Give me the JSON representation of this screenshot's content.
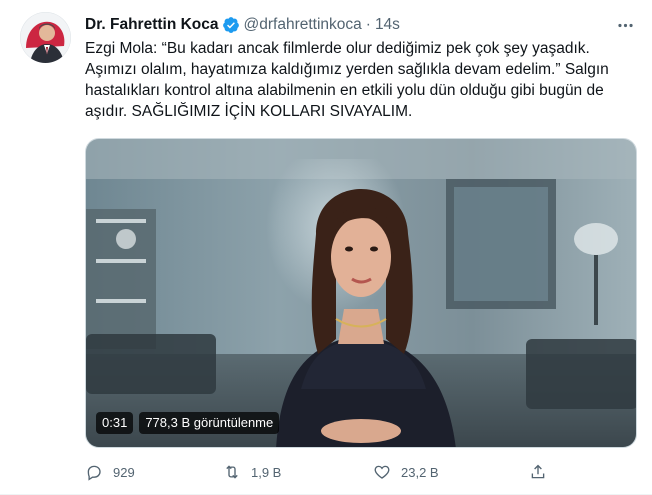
{
  "author": {
    "name": "Dr. Fahrettin Koca",
    "handle": "@drfahrettinkoca",
    "separator": "·",
    "time": "14s"
  },
  "tweet": {
    "text": "Ezgi Mola: “Bu kadarı ancak filmlerde olur dediğimiz pek çok şey yaşadık. Aşımızı olalım, hayatımıza kaldığımız yerden sağlıkla devam edelim.” Salgın hastalıkları kontrol altına alabilmenin en etkili yolu dün olduğu gibi bugün de aşıdır. SAĞLIĞIMIZ İÇİN KOLLARI SIVAYALIM."
  },
  "video": {
    "duration": "0:31",
    "views": "778,3 B görüntülenme"
  },
  "actions": {
    "replies": "929",
    "retweets": "1,9 B",
    "likes": "23,2 B"
  },
  "colors": {
    "verified": "#1d9bf0",
    "muted_text": "#536471",
    "primary_text": "#0f1419"
  },
  "icons": [
    "verified-badge-icon",
    "more-options-icon",
    "reply-icon",
    "retweet-icon",
    "like-icon",
    "share-icon"
  ]
}
